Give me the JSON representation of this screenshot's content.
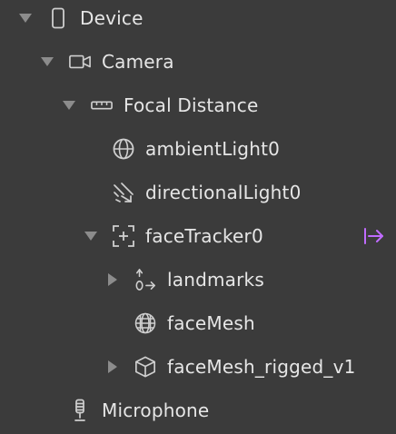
{
  "tree": {
    "device": {
      "label": "Device",
      "icon": "phone-icon",
      "expanded": true
    },
    "camera": {
      "label": "Camera",
      "icon": "camera-icon",
      "expanded": true
    },
    "focal_distance": {
      "label": "Focal Distance",
      "icon": "ruler-icon",
      "expanded": true
    },
    "ambient_light": {
      "label": "ambientLight0",
      "icon": "globe-icon"
    },
    "directional_light": {
      "label": "directionalLight0",
      "icon": "directional-light-icon"
    },
    "face_tracker": {
      "label": "faceTracker0",
      "icon": "face-tracker-icon",
      "expanded": true,
      "action_icon": "link-arrow-icon",
      "action_color": "#c06bff"
    },
    "landmarks": {
      "label": "landmarks",
      "icon": "landmarks-icon",
      "expanded": false
    },
    "face_mesh": {
      "label": "faceMesh",
      "icon": "mesh-globe-icon"
    },
    "face_mesh_rigged": {
      "label": "faceMesh_rigged_v1",
      "icon": "cube-icon",
      "expanded": false
    },
    "microphone": {
      "label": "Microphone",
      "icon": "microphone-icon"
    }
  }
}
